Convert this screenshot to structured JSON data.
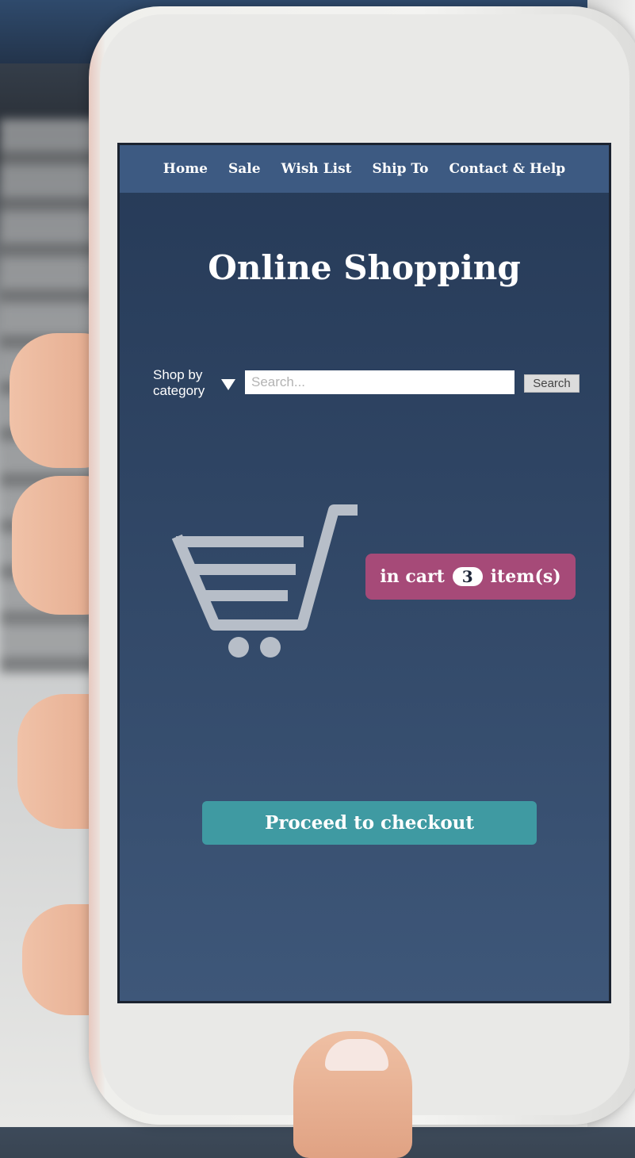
{
  "nav": {
    "items": [
      {
        "label": "Home"
      },
      {
        "label": "Sale"
      },
      {
        "label": "Wish List"
      },
      {
        "label": "Ship To"
      },
      {
        "label": "Contact & Help"
      }
    ]
  },
  "title": "Online Shopping",
  "search": {
    "category_label": "Shop by category",
    "placeholder": "Search...",
    "button_label": "Search"
  },
  "cart": {
    "prefix": "in cart",
    "count": "3",
    "suffix": "item(s)",
    "icon": "shopping-cart-icon"
  },
  "checkout": {
    "label": "Proceed to checkout"
  },
  "colors": {
    "navbar": "#3d5a82",
    "screen_top": "#263a57",
    "screen_bottom": "#3e5779",
    "cart_badge": "#a64a78",
    "checkout_button": "#3f9aa2",
    "cart_icon": "#b7bec8"
  }
}
